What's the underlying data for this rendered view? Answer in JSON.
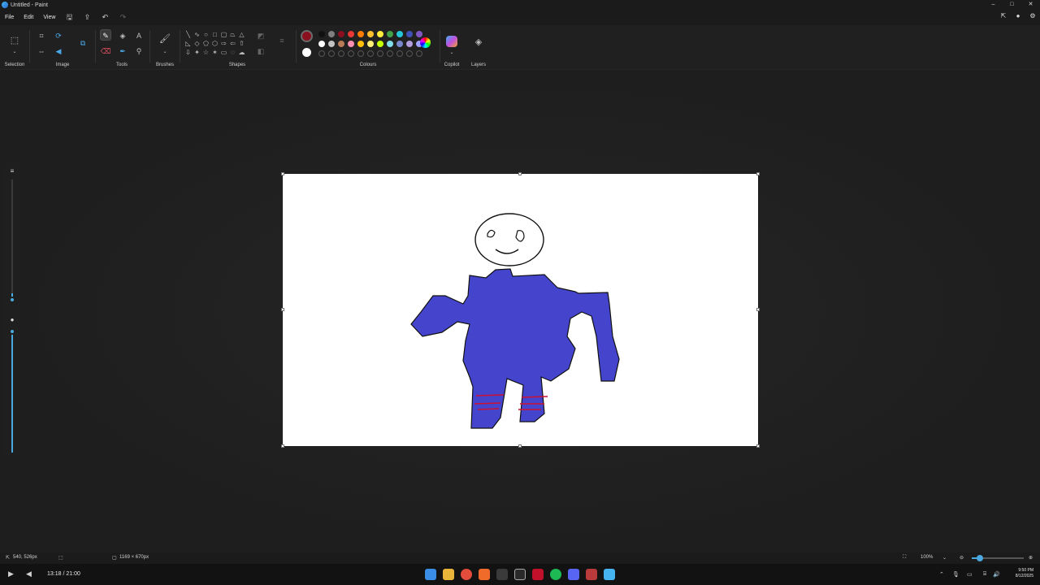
{
  "window": {
    "title": "Untitled - Paint",
    "controls": [
      "–",
      "□",
      "✕"
    ]
  },
  "menu": {
    "items": [
      "File",
      "Edit",
      "View"
    ]
  },
  "ribbon": {
    "groups": {
      "selection": "Selection",
      "image": "Image",
      "tools": "Tools",
      "brushes": "Brushes",
      "shapes": "Shapes",
      "colours": "Colours",
      "copilot": "Copilot",
      "layers": "Layers"
    },
    "primary_colour": "#8a1020",
    "secondary_colour": "#ffffff",
    "palette_row1": [
      "#111111",
      "#7f7f7f",
      "#8a1020",
      "#e53935",
      "#f57c00",
      "#fbc02d",
      "#ffeb3b",
      "#43a047",
      "#26c6da",
      "#3f51b5",
      "#7e57c2"
    ],
    "palette_row2": [
      "#ffffff",
      "#c3c3c3",
      "#b97a57",
      "#ff8fb1",
      "#ffc107",
      "#fff176",
      "#c6ff00",
      "#80deea",
      "#7986cb",
      "#b39ddb",
      "#a0a0ff"
    ]
  },
  "canvas": {
    "background": "#ffffff",
    "figure_fill": "#4444cc",
    "stripe_colour": "#cc1133"
  },
  "status": {
    "cursor_position": "540, 526px",
    "canvas_size": "1169 × 670px",
    "zoom": "100%",
    "zoom_fraction": 0.15
  },
  "taskbar": {
    "media_time": "13:18 / 21:00",
    "clock_time": "9:50 PM",
    "clock_date": "8/12/2025"
  }
}
